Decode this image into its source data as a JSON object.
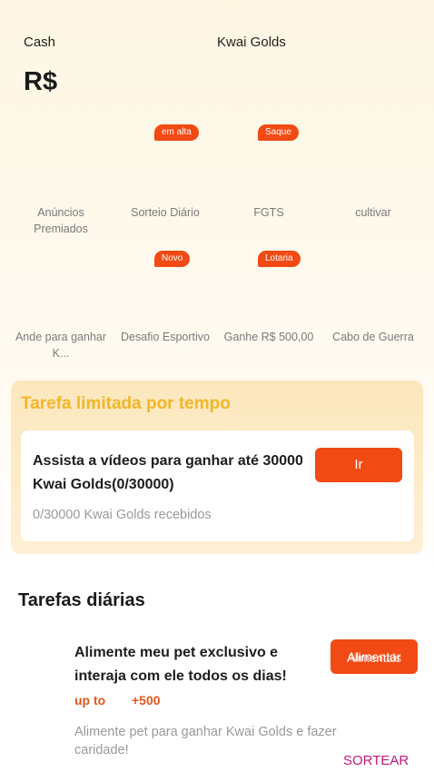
{
  "header": {
    "cash_label": "Cash",
    "golds_label": "Kwai Golds",
    "currency_symbol": "R$"
  },
  "features_row1": [
    {
      "label": "Anúncios Premiados",
      "badge": "",
      "icon": "gift-icon"
    },
    {
      "label": "Sorteio Diário",
      "badge": "em alta",
      "icon": "lottery-icon"
    },
    {
      "label": "FGTS",
      "badge": "Saque",
      "icon": "wallet-icon"
    },
    {
      "label": "cultivar",
      "badge": "",
      "icon": "plant-icon"
    }
  ],
  "features_row2": [
    {
      "label": "Ande para ganhar K...",
      "badge": "",
      "icon": "walk-icon"
    },
    {
      "label": "Desafio Esportivo",
      "badge": "Novo",
      "icon": "trophy-icon"
    },
    {
      "label": "Ganhe R$ 500,00",
      "badge": "Lotaria",
      "icon": "coin-icon"
    },
    {
      "label": "Cabo de Guerra",
      "badge": "",
      "icon": "rope-icon"
    }
  ],
  "limited": {
    "title": "Tarefa limitada por tempo",
    "task_text": "Assista a vídeos para ganhar até 30000 Kwai Golds(0/30000)",
    "progress_text": "0/30000 Kwai Golds recebidos",
    "button_label": "Ir"
  },
  "daily": {
    "heading": "Tarefas diárias",
    "task_text": "Alimente meu pet exclusivo e interaja com ele todos os dias!",
    "reward_prefix": "up to",
    "reward_amount": "+500",
    "description": "Alimente pet para ganhar Kwai Golds e fazer caridade!",
    "button_label": "Alimentar",
    "button_label_overlay": "Alimentais"
  },
  "footer_link": "SORTEAR",
  "colors": {
    "accent": "#f24a14",
    "limited_title": "#f3b627",
    "sortear": "#c2187a"
  }
}
